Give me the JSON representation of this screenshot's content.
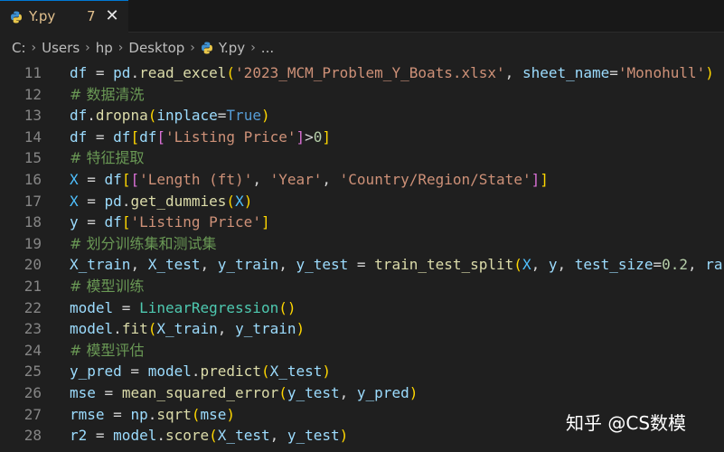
{
  "tab": {
    "title": "Y.py",
    "problem_count": "7",
    "close_glyph": "✕",
    "accent_color": "#e2c08d"
  },
  "breadcrumb": [
    {
      "label": "C:"
    },
    {
      "label": "Users"
    },
    {
      "label": "hp"
    },
    {
      "label": "Desktop"
    },
    {
      "label": "Y.py",
      "icon": "python-icon"
    },
    {
      "label": "..."
    }
  ],
  "breadcrumb_separator": "›",
  "editor": {
    "lines": [
      {
        "n": "11",
        "tokens": [
          [
            "t-var",
            "df"
          ],
          [
            "t-op",
            " = "
          ],
          [
            "t-var",
            "pd"
          ],
          [
            "t-op",
            "."
          ],
          [
            "t-fn",
            "read_excel"
          ],
          [
            "t-b1",
            "("
          ],
          [
            "t-str",
            "'2023_MCM_Problem_Y_Boats.xlsx'"
          ],
          [
            "t-op",
            ", "
          ],
          [
            "t-var",
            "sheet_name"
          ],
          [
            "t-op",
            "="
          ],
          [
            "t-str",
            "'Monohull'"
          ],
          [
            "t-b1",
            ")"
          ]
        ]
      },
      {
        "n": "12",
        "tokens": [
          [
            "t-cmt",
            "# 数据清洗"
          ]
        ]
      },
      {
        "n": "13",
        "tokens": [
          [
            "t-var",
            "df"
          ],
          [
            "t-op",
            "."
          ],
          [
            "t-fn",
            "dropna"
          ],
          [
            "t-b1",
            "("
          ],
          [
            "t-var",
            "inplace"
          ],
          [
            "t-op",
            "="
          ],
          [
            "t-kw",
            "True"
          ],
          [
            "t-b1",
            ")"
          ]
        ]
      },
      {
        "n": "14",
        "tokens": [
          [
            "t-var",
            "df"
          ],
          [
            "t-op",
            " = "
          ],
          [
            "t-var",
            "df"
          ],
          [
            "t-b1",
            "["
          ],
          [
            "t-var",
            "df"
          ],
          [
            "t-b2",
            "["
          ],
          [
            "t-str",
            "'Listing Price'"
          ],
          [
            "t-b2",
            "]"
          ],
          [
            "t-op",
            ">"
          ],
          [
            "t-num",
            "0"
          ],
          [
            "t-b1",
            "]"
          ]
        ]
      },
      {
        "n": "15",
        "tokens": [
          [
            "t-cmt",
            "# 特征提取"
          ]
        ]
      },
      {
        "n": "16",
        "tokens": [
          [
            "t-const",
            "X"
          ],
          [
            "t-op",
            " = "
          ],
          [
            "t-var",
            "df"
          ],
          [
            "t-b1",
            "["
          ],
          [
            "t-b2",
            "["
          ],
          [
            "t-str",
            "'Length (ft)'"
          ],
          [
            "t-op",
            ", "
          ],
          [
            "t-str",
            "'Year'"
          ],
          [
            "t-op",
            ", "
          ],
          [
            "t-str",
            "'Country/Region/State'"
          ],
          [
            "t-b2",
            "]"
          ],
          [
            "t-b1",
            "]"
          ]
        ]
      },
      {
        "n": "17",
        "tokens": [
          [
            "t-const",
            "X"
          ],
          [
            "t-op",
            " = "
          ],
          [
            "t-var",
            "pd"
          ],
          [
            "t-op",
            "."
          ],
          [
            "t-fn",
            "get_dummies"
          ],
          [
            "t-b1",
            "("
          ],
          [
            "t-const",
            "X"
          ],
          [
            "t-b1",
            ")"
          ]
        ]
      },
      {
        "n": "18",
        "tokens": [
          [
            "t-var",
            "y"
          ],
          [
            "t-op",
            " = "
          ],
          [
            "t-var",
            "df"
          ],
          [
            "t-b1",
            "["
          ],
          [
            "t-str",
            "'Listing Price'"
          ],
          [
            "t-b1",
            "]"
          ]
        ]
      },
      {
        "n": "19",
        "tokens": [
          [
            "t-cmt",
            "# 划分训练集和测试集"
          ]
        ]
      },
      {
        "n": "20",
        "tokens": [
          [
            "t-var",
            "X_train"
          ],
          [
            "t-op",
            ", "
          ],
          [
            "t-var",
            "X_test"
          ],
          [
            "t-op",
            ", "
          ],
          [
            "t-var",
            "y_train"
          ],
          [
            "t-op",
            ", "
          ],
          [
            "t-var",
            "y_test"
          ],
          [
            "t-op",
            " = "
          ],
          [
            "t-fn",
            "train_test_split"
          ],
          [
            "t-b1",
            "("
          ],
          [
            "t-const",
            "X"
          ],
          [
            "t-op",
            ", "
          ],
          [
            "t-var",
            "y"
          ],
          [
            "t-op",
            ", "
          ],
          [
            "t-var",
            "test_size"
          ],
          [
            "t-op",
            "="
          ],
          [
            "t-num",
            "0.2"
          ],
          [
            "t-op",
            ", "
          ],
          [
            "t-var",
            "ran"
          ]
        ]
      },
      {
        "n": "21",
        "tokens": [
          [
            "t-cmt",
            "# 模型训练"
          ]
        ]
      },
      {
        "n": "22",
        "tokens": [
          [
            "t-var",
            "model"
          ],
          [
            "t-op",
            " = "
          ],
          [
            "t-cls",
            "LinearRegression"
          ],
          [
            "t-b1",
            "()"
          ]
        ]
      },
      {
        "n": "23",
        "tokens": [
          [
            "t-var",
            "model"
          ],
          [
            "t-op",
            "."
          ],
          [
            "t-fn",
            "fit"
          ],
          [
            "t-b1",
            "("
          ],
          [
            "t-var",
            "X_train"
          ],
          [
            "t-op",
            ", "
          ],
          [
            "t-var",
            "y_train"
          ],
          [
            "t-b1",
            ")"
          ]
        ]
      },
      {
        "n": "24",
        "tokens": [
          [
            "t-cmt",
            "# 模型评估"
          ]
        ]
      },
      {
        "n": "25",
        "tokens": [
          [
            "t-var",
            "y_pred"
          ],
          [
            "t-op",
            " = "
          ],
          [
            "t-var",
            "model"
          ],
          [
            "t-op",
            "."
          ],
          [
            "t-fn",
            "predict"
          ],
          [
            "t-b1",
            "("
          ],
          [
            "t-var",
            "X_test"
          ],
          [
            "t-b1",
            ")"
          ]
        ]
      },
      {
        "n": "26",
        "tokens": [
          [
            "t-var",
            "mse"
          ],
          [
            "t-op",
            " = "
          ],
          [
            "t-fn",
            "mean_squared_error"
          ],
          [
            "t-b1",
            "("
          ],
          [
            "t-var",
            "y_test"
          ],
          [
            "t-op",
            ", "
          ],
          [
            "t-var",
            "y_pred"
          ],
          [
            "t-b1",
            ")"
          ]
        ]
      },
      {
        "n": "27",
        "tokens": [
          [
            "t-var",
            "rmse"
          ],
          [
            "t-op",
            " = "
          ],
          [
            "t-var",
            "np"
          ],
          [
            "t-op",
            "."
          ],
          [
            "t-fn",
            "sqrt"
          ],
          [
            "t-b1",
            "("
          ],
          [
            "t-var",
            "mse"
          ],
          [
            "t-b1",
            ")"
          ]
        ]
      },
      {
        "n": "28",
        "tokens": [
          [
            "t-var",
            "r2"
          ],
          [
            "t-op",
            " = "
          ],
          [
            "t-var",
            "model"
          ],
          [
            "t-op",
            "."
          ],
          [
            "t-fn",
            "score"
          ],
          [
            "t-b1",
            "("
          ],
          [
            "t-var",
            "X_test"
          ],
          [
            "t-op",
            ", "
          ],
          [
            "t-var",
            "y_test"
          ],
          [
            "t-b1",
            ")"
          ]
        ]
      }
    ]
  },
  "watermark": "知乎 @CS数模"
}
